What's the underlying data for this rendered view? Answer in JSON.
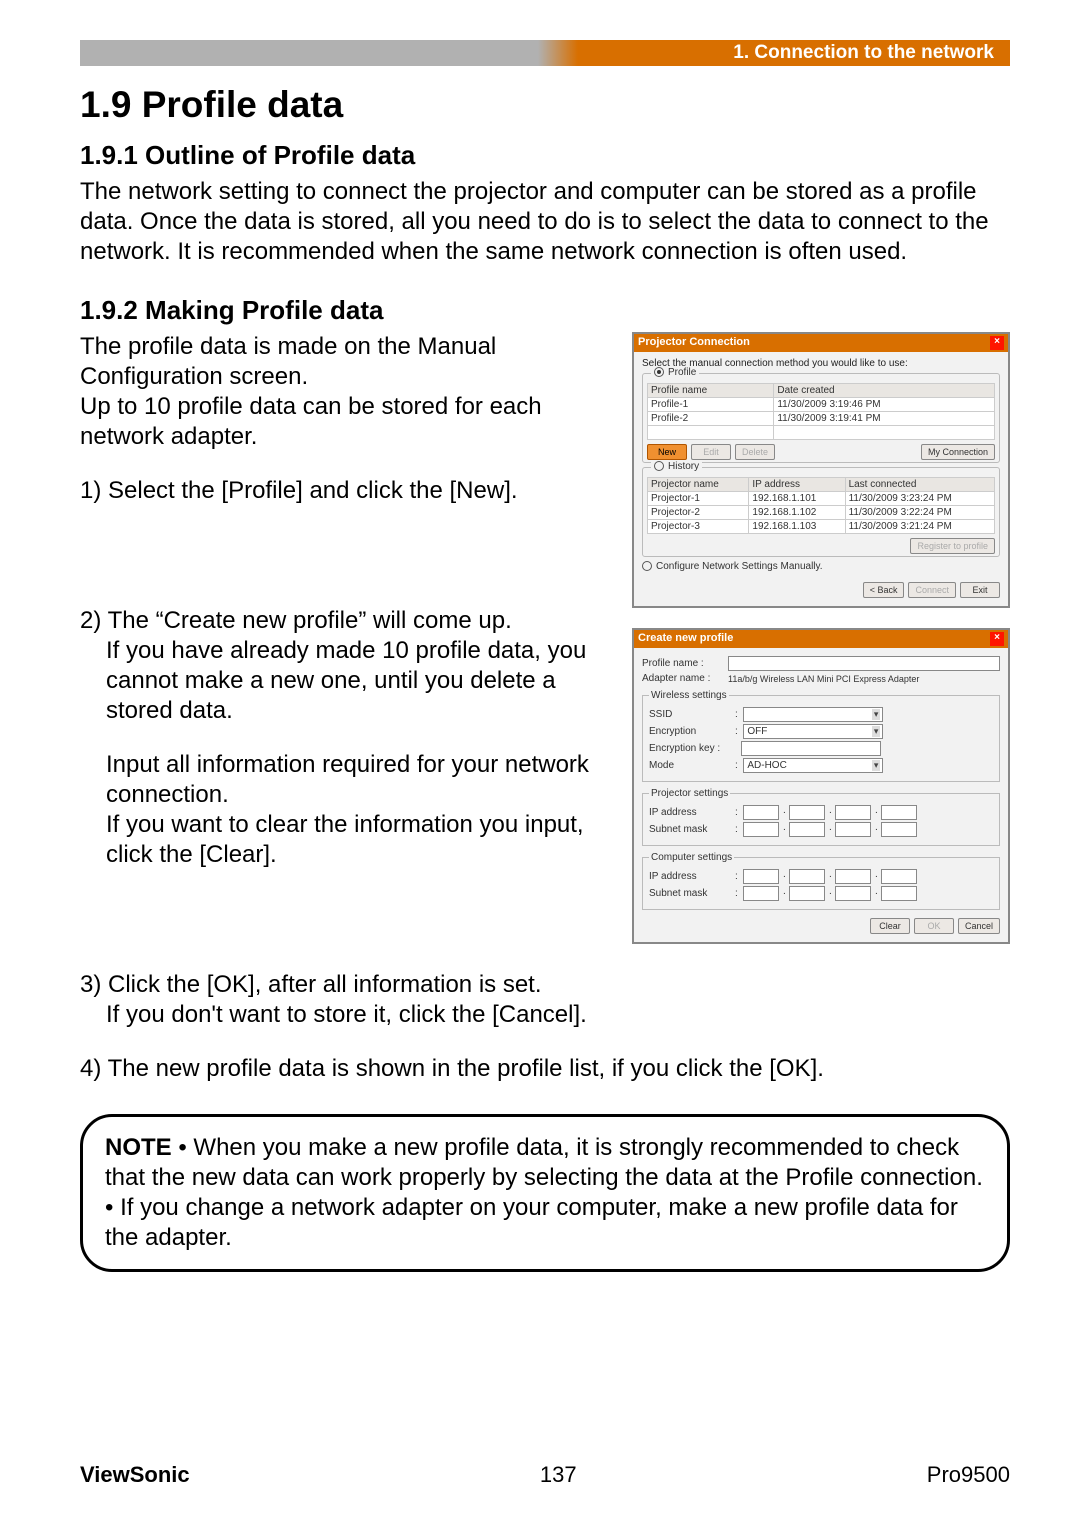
{
  "header": {
    "section_label": "1. Connection to the network"
  },
  "h1": "1.9 Profile data",
  "h2a": "1.9.1 Outline of Profile data",
  "para1": "The network setting to connect the projector and computer can be stored as a profile data. Once the data is stored, all you need to do is to select the data to connect to the network. It is recommended when the same network connection is often used.",
  "h2b": "1.9.2 Making Profile data",
  "para2a": "The profile data is made on the Manual Configuration screen.",
  "para2b": "Up to 10 profile data can be stored for each network adapter.",
  "step1": "1) Select the [Profile] and click the [New].",
  "step2a": "2) The “Create new profile” will come up.",
  "step2b": "If you have already made 10 profile data, you cannot make a new one, until you delete a stored data.",
  "step2c": "Input all information required for your network connection.",
  "step2d": "If you want to clear the information you input, click the [Clear].",
  "step3a": "3) Click the [OK], after all information is set.",
  "step3b": "If you don't want to store it, click the [Cancel].",
  "step4": "4) The new profile data is shown in the profile list, if you click the [OK].",
  "note_label": "NOTE",
  "note_a": "• When you make a new profile data, it is strongly recommended to check that the new data can work properly by selecting the data at the Profile connection.",
  "note_b": "• If you change a network adapter on your computer, make a new profile data for the adapter.",
  "dialog1": {
    "title": "Projector Connection",
    "hint": "Select the manual connection method you would like to use:",
    "profile_label": "Profile",
    "profile_header_name": "Profile name",
    "profile_header_date": "Date created",
    "profile_rows": [
      {
        "name": "Profile-1",
        "date": "11/30/2009 3:19:46 PM"
      },
      {
        "name": "Profile-2",
        "date": "11/30/2009 3:19:41 PM"
      }
    ],
    "btn_new": "New",
    "btn_edit": "Edit",
    "btn_delete": "Delete",
    "btn_myconn": "My Connection",
    "history_label": "History",
    "history_header_name": "Projector name",
    "history_header_ip": "IP address",
    "history_header_last": "Last connected",
    "history_rows": [
      {
        "name": "Projector-1",
        "ip": "192.168.1.101",
        "last": "11/30/2009 3:23:24 PM"
      },
      {
        "name": "Projector-2",
        "ip": "192.168.1.102",
        "last": "11/30/2009 3:22:24 PM"
      },
      {
        "name": "Projector-3",
        "ip": "192.168.1.103",
        "last": "11/30/2009 3:21:24 PM"
      }
    ],
    "btn_reg": "Register to profile",
    "manual_label": "Configure Network Settings Manually.",
    "btn_back": "< Back",
    "btn_connect": "Connect",
    "btn_exit": "Exit"
  },
  "dialog2": {
    "title": "Create new profile",
    "profile_name_label": "Profile name   :",
    "adapter_label": "Adapter name  :",
    "adapter_value": "11a/b/g Wireless LAN Mini PCI Express Adapter",
    "wireless_legend": "Wireless settings",
    "ssid_label": "SSID",
    "encryption_label": "Encryption",
    "encryption_value": "OFF",
    "encryptionkey_label": "Encryption key :",
    "mode_label": "Mode",
    "mode_value": "AD-HOC",
    "projector_legend": "Projector settings",
    "ip_label": "IP address",
    "subnet_label": "Subnet mask",
    "computer_legend": "Computer settings",
    "btn_clear": "Clear",
    "btn_ok": "OK",
    "btn_cancel": "Cancel"
  },
  "footer": {
    "left": "ViewSonic",
    "center": "137",
    "right": "Pro9500"
  }
}
